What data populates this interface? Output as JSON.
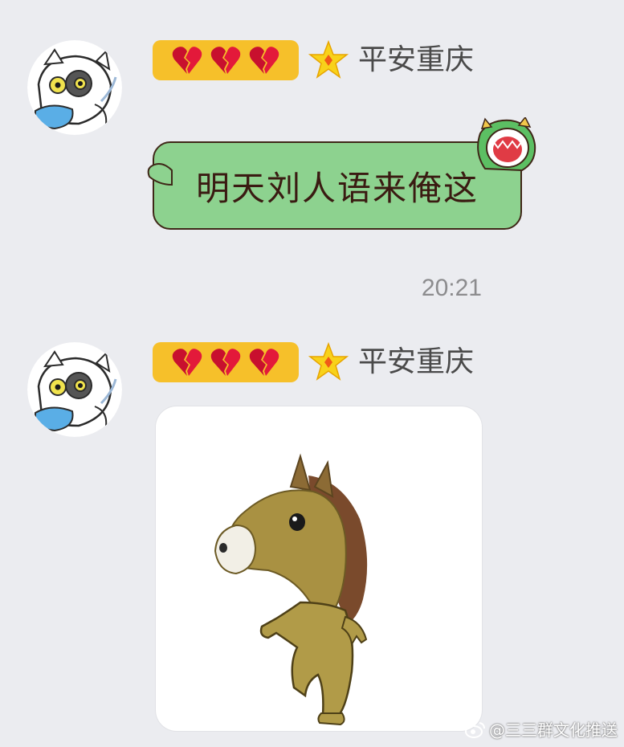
{
  "messages": [
    {
      "sender": "平安重庆",
      "badge": {
        "hearts": 3,
        "color": "#f6c02a"
      },
      "text": "明天刘人语来俺这",
      "bubble_color": "#8dd28f"
    },
    {
      "sender": "平安重庆",
      "badge": {
        "hearts": 3,
        "color": "#f6c02a"
      },
      "image": "horse-sticker"
    }
  ],
  "timestamp": "20:21",
  "watermark": {
    "icon": "weibo-icon",
    "text": "@三三群文化推送"
  }
}
